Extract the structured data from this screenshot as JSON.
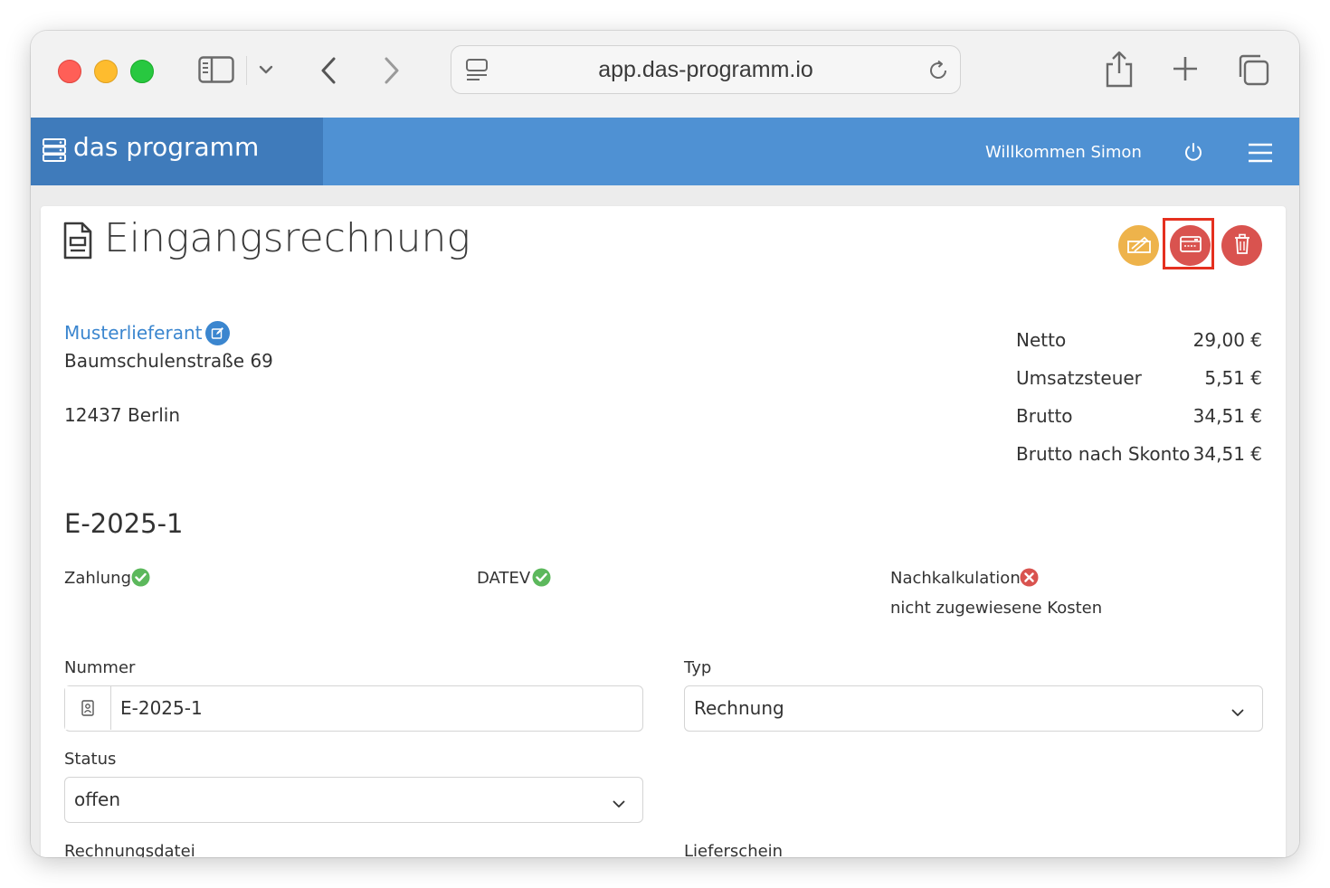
{
  "browser": {
    "url": "app.das-programm.io"
  },
  "app": {
    "brand": "das programm",
    "welcome": "Willkommen Simon"
  },
  "page": {
    "title": "Eingangsrechnung"
  },
  "supplier": {
    "name": "Musterlieferant",
    "street": "Baumschulenstraße 69",
    "city": "12437 Berlin"
  },
  "summary": {
    "netto_label": "Netto",
    "netto_value": "29,00 €",
    "ust_label": "Umsatzsteuer",
    "ust_value": "5,51 €",
    "brutto_label": "Brutto",
    "brutto_value": "34,51 €",
    "skonto_label": "Brutto nach Skonto",
    "skonto_value": "34,51 €"
  },
  "invoice": {
    "number_heading": "E-2025-1"
  },
  "status_flags": {
    "zahlung_label": "Zahlung",
    "datev_label": "DATEV",
    "nachkalkulation_label": "Nachkalkulation",
    "nachkalkulation_note": "nicht zugewiesene Kosten"
  },
  "form": {
    "nummer_label": "Nummer",
    "nummer_value": "E-2025-1",
    "typ_label": "Typ",
    "typ_value": "Rechnung",
    "status_label": "Status",
    "status_value": "offen",
    "rechnungsdatei_label": "Rechnungsdatei",
    "lieferschein_label": "Lieferschein"
  },
  "colors": {
    "appbar": "#4f91d3",
    "brand_bg": "#3f7bbb",
    "link": "#3b86cf",
    "orange_button": "#eeb34b",
    "red_button": "#d9534f",
    "success": "#5cb85c",
    "danger": "#d9534f",
    "highlight": "#e5301f"
  },
  "icons": {
    "toolbar": [
      "sidebar-icon",
      "chevron-down-icon",
      "back-icon",
      "forward-icon",
      "reader-icon",
      "reload-icon",
      "share-icon",
      "new-tab-icon",
      "tabs-overview-icon"
    ],
    "app": [
      "server-icon",
      "power-icon",
      "hamburger-menu-icon",
      "document-icon",
      "edit-icon",
      "check-circle-icon",
      "x-circle-icon",
      "id-badge-icon"
    ],
    "actions": [
      "sign-icon",
      "payment-card-icon",
      "trash-icon"
    ]
  }
}
